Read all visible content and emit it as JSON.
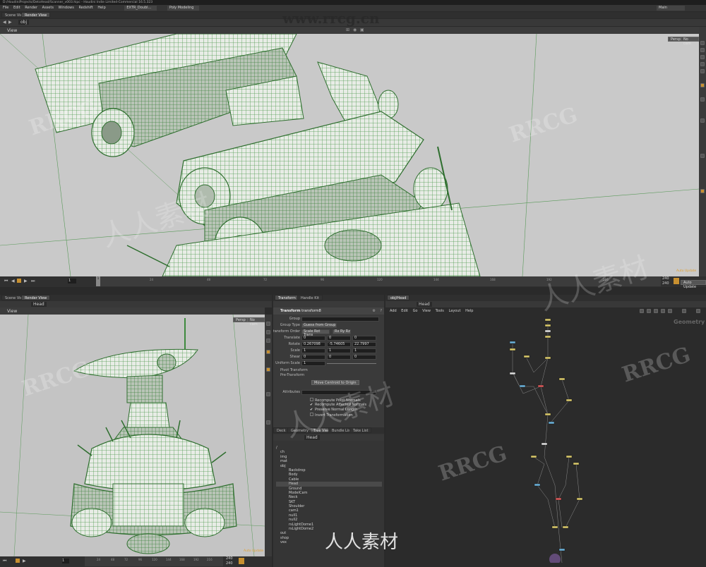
{
  "window": {
    "title": "D:/HoudiniProjects/DetoHead/Scanner_v003.hipc - Houdini Indie Limited-Commercial 16.5.323",
    "menu": [
      "File",
      "Edit",
      "Render",
      "Assets",
      "Windows",
      "Redshift",
      "Help"
    ],
    "shelf_set": "EXTR_Doubl...",
    "shelf_active": "Poly Modeling",
    "desktop": "Main"
  },
  "top_viewport": {
    "tabs": [
      "Scene View",
      "Render View"
    ],
    "path": "obj",
    "view_label": "View",
    "corner_buttons": [
      "Persp",
      "No cam"
    ],
    "status": "Auto Update"
  },
  "timeline_top": {
    "frame": "1",
    "start": "1",
    "end": "240",
    "end2": "240",
    "ticks": [
      "24",
      "48",
      "72",
      "96",
      "120",
      "144",
      "168",
      "192",
      "216"
    ],
    "cursor_frame": "1"
  },
  "left_viewport": {
    "tabs": [
      "Scene View",
      "Render View"
    ],
    "path": "Head",
    "view_label": "View",
    "corner_buttons": [
      "Persp",
      "No cam"
    ],
    "status": "Auto Update"
  },
  "timeline_bottom": {
    "frame": "1",
    "start": "1",
    "end": "240",
    "end2": "240",
    "ticks": [
      "24",
      "48",
      "72",
      "96",
      "120",
      "144",
      "168",
      "192",
      "216"
    ]
  },
  "params": {
    "tabs": [
      "Transform",
      "Handle Kit"
    ],
    "node_type": "Transform",
    "node_name": "transform8",
    "rows": [
      {
        "label": "Group",
        "values": [
          ""
        ]
      },
      {
        "label": "Group Type",
        "values": [
          "Guess from Group"
        ]
      },
      {
        "label": "Transform Order",
        "values": [
          "Scale Rot Trans",
          "Rx Ry Rz"
        ]
      },
      {
        "label": "Translate",
        "values": [
          "0",
          "0",
          "0"
        ]
      },
      {
        "label": "Rotate",
        "values": [
          "0.267098",
          "-5.74605",
          "22.7997"
        ]
      },
      {
        "label": "Scale",
        "values": [
          "1",
          "1",
          "1"
        ]
      },
      {
        "label": "Shear",
        "values": [
          "0",
          "0",
          "0"
        ]
      },
      {
        "label": "Uniform Scale",
        "values": [
          "1"
        ]
      }
    ],
    "sections": [
      "Pivot Transform",
      "Pre-Transform"
    ],
    "move_button": "Move Centroid to Origin",
    "attributes_label": "Attributes",
    "checks": [
      {
        "label": "Recompute Point Normals",
        "checked": false
      },
      {
        "label": "Recompute Affected Normals",
        "checked": true
      },
      {
        "label": "Preserve Normal Length",
        "checked": true
      },
      {
        "label": "Invert Transformation",
        "checked": false
      }
    ]
  },
  "tree": {
    "tabs": [
      "Deck",
      "Geometry S...",
      "Tree View",
      "Bundle List",
      "Take List"
    ],
    "path": "Head",
    "items": [
      "/",
      "ch",
      "img",
      "mat",
      "obj",
      "Backdrop",
      "Body",
      "Cable",
      "Head",
      "Ground",
      "ModelCam",
      "Neck",
      "SKT",
      "Shoulder",
      "cam1",
      "null1",
      "null2",
      "rsLightDome1",
      "rsLightDome2",
      "out",
      "shop",
      "vex"
    ]
  },
  "network": {
    "tabs": [
      "obj/Head"
    ],
    "path": "Head",
    "menu": [
      "Add",
      "Edit",
      "Go",
      "View",
      "Tools",
      "Layout",
      "Help"
    ],
    "context_label": "Geometry"
  },
  "watermarks": {
    "site": "www.rrcg.cn",
    "latin": "RRCG",
    "cn": "人人素材"
  },
  "colors": {
    "wire_green": "#5a9a5a",
    "viewport_bg": "#c8c8c8",
    "accent_orange": "#e0a030"
  }
}
